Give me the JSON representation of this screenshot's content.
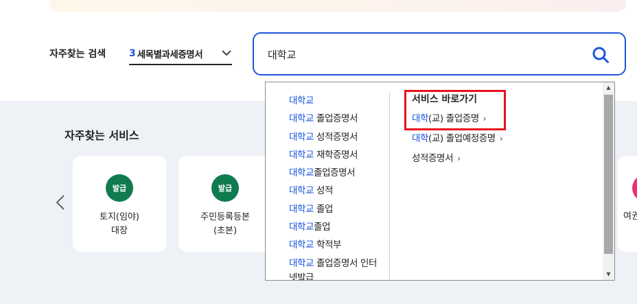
{
  "faq_search": {
    "label": "자주찾는 검색",
    "rank": "3",
    "selected": "세목별과세증명서"
  },
  "search": {
    "value": "대학교",
    "placeholder": ""
  },
  "services": {
    "title": "자주찾는 서비스",
    "cards": [
      {
        "badge": "발급",
        "line1": "토지(임야)",
        "line2": "대장"
      },
      {
        "badge": "발급",
        "line1": "주민등록등본",
        "line2": "(초본)"
      }
    ],
    "partial_card_label": "여권"
  },
  "suggestions": [
    {
      "hl": "대학교",
      "rest": ""
    },
    {
      "hl": "대학교",
      "rest": " 졸업증명서"
    },
    {
      "hl": "대학교",
      "rest": " 성적증명서"
    },
    {
      "hl": "대학교",
      "rest": " 재학증명서"
    },
    {
      "hl": "대학교",
      "rest": "졸업증명서"
    },
    {
      "hl": "대학교",
      "rest": " 성적"
    },
    {
      "hl": "대학교",
      "rest": " 졸업"
    },
    {
      "hl": "대학교",
      "rest": "졸업"
    },
    {
      "hl": "대학교",
      "rest": " 학적부"
    },
    {
      "hl": "대학교",
      "rest": " 졸업증명서 인터"
    },
    {
      "hl": "",
      "rest": "넷발급"
    }
  ],
  "shortcut": {
    "title": "서비스 바로가기",
    "items": [
      {
        "hl": "대학",
        "rest": "(교) 졸업증명",
        "arrow": "›"
      },
      {
        "hl": "대학",
        "rest": "(교) 졸업예정증명",
        "arrow": "›"
      },
      {
        "hl": "",
        "rest": "성적증명서",
        "arrow": "›"
      }
    ]
  },
  "scrollbar": {
    "up": "▲",
    "down": "▼"
  },
  "colors": {
    "accent": "#1a56db",
    "highlight_box": "#e5121c",
    "badge_green": "#0f7b4f"
  }
}
